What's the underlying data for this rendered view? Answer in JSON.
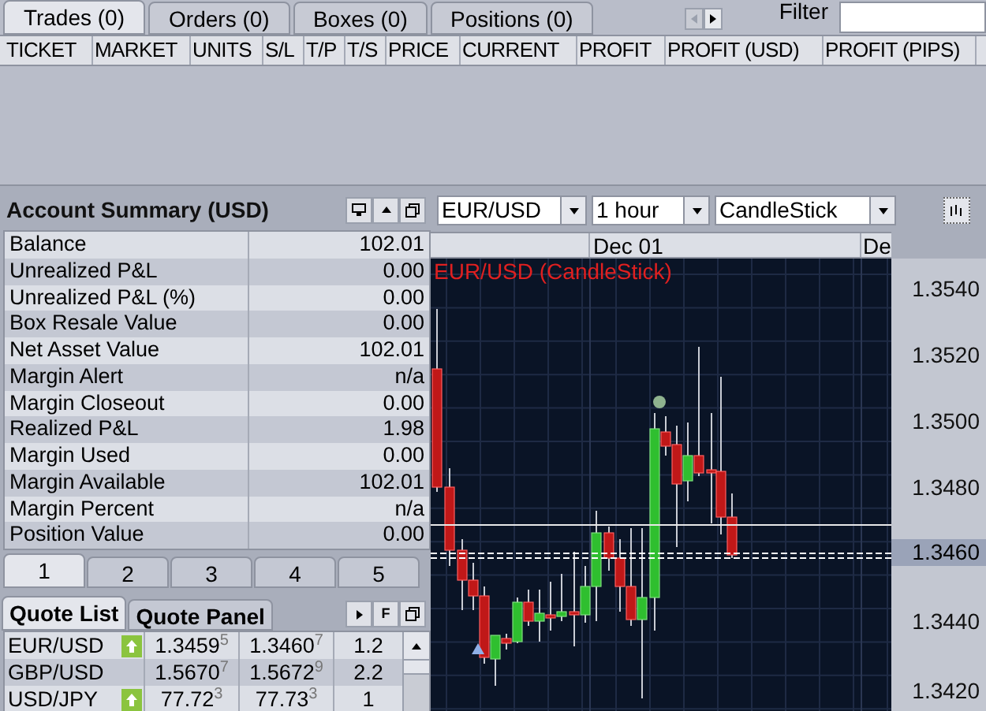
{
  "top_tabs": [
    {
      "label": "Trades (0)",
      "selected": true
    },
    {
      "label": "Orders (0)",
      "selected": false
    },
    {
      "label": "Boxes (0)",
      "selected": false
    },
    {
      "label": "Positions (0)",
      "selected": false
    }
  ],
  "filter": {
    "label": "Filter"
  },
  "trades_table": {
    "columns": [
      "TICKET",
      "MARKET",
      "UNITS",
      "S/L",
      "T/P",
      "T/S",
      "PRICE",
      "CURRENT",
      "PROFIT",
      "PROFIT (USD)",
      "PROFIT (PIPS)"
    ]
  },
  "account_summary": {
    "title": "Account Summary (USD)",
    "rows": [
      {
        "label": "Balance",
        "value": "102.01"
      },
      {
        "label": "Unrealized P&L",
        "value": "0.00"
      },
      {
        "label": "Unrealized P&L (%)",
        "value": "0.00"
      },
      {
        "label": "Box Resale Value",
        "value": "0.00"
      },
      {
        "label": "Net Asset Value",
        "value": "102.01"
      },
      {
        "label": "Margin Alert",
        "value": "n/a"
      },
      {
        "label": "Margin Closeout",
        "value": "0.00"
      },
      {
        "label": "Realized P&L",
        "value": "1.98"
      },
      {
        "label": "Margin Used",
        "value": "0.00"
      },
      {
        "label": "Margin Available",
        "value": "102.01"
      },
      {
        "label": "Margin Percent",
        "value": "n/a"
      },
      {
        "label": "Position Value",
        "value": "0.00"
      }
    ]
  },
  "page_tabs": [
    {
      "label": "1",
      "selected": true
    },
    {
      "label": "2",
      "selected": false
    },
    {
      "label": "3",
      "selected": false
    },
    {
      "label": "4",
      "selected": false
    },
    {
      "label": "5",
      "selected": false
    }
  ],
  "quote_tabs": [
    {
      "label": "Quote List",
      "selected": true
    },
    {
      "label": "Quote Panel",
      "selected": false
    }
  ],
  "quote_buttons": [
    "F"
  ],
  "quotes": [
    {
      "pair": "EUR/USD",
      "up": true,
      "bid": "1.3459$^{5}$",
      "ask": "1.3460$^{7}$",
      "spread": "1.2"
    },
    {
      "pair": "GBP/USD",
      "up": false,
      "bid": "1.5670$^{7}$",
      "ask": "1.5672$^{9}$",
      "spread": "2.2"
    },
    {
      "pair": "USD/JPY",
      "up": true,
      "bid": "77.72$^{3}$",
      "ask": "77.73$^{3}$",
      "spread": "1"
    }
  ],
  "chart": {
    "instrument": "EUR/USD",
    "interval": "1 hour",
    "style": "CandleStick",
    "date_labels": [
      "Dec 01",
      "De"
    ],
    "legend": "EUR/USD (CandleStick)",
    "price_labels": [
      "1.3540",
      "1.3520",
      "1.3500",
      "1.3480",
      "1.3440",
      "1.3420"
    ],
    "current_price": "1.3460"
  }
}
